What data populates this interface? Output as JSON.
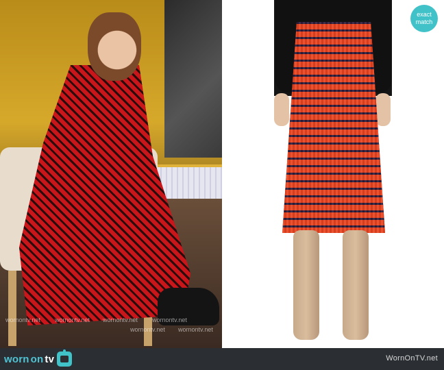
{
  "badge": {
    "line1": "exact",
    "line2": "match"
  },
  "watermark_text": "wornontv.net",
  "footer": {
    "logo_worn": "worn",
    "logo_on": "on",
    "logo_tv": "tv",
    "site": "WornOnTV.net",
    "icon": "tv-icon"
  },
  "colors": {
    "accent": "#41c2c9",
    "footer_bg": "#2b2f33"
  }
}
